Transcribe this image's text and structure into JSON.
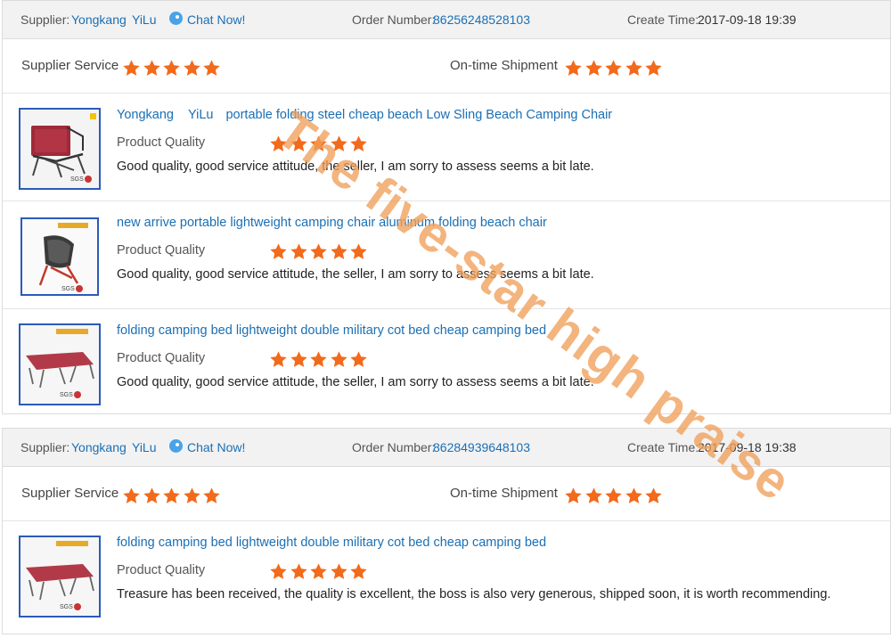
{
  "labels": {
    "supplier": "Supplier:",
    "chat_now": "Chat Now!",
    "order_number": "Order Number:",
    "create_time": "Create Time:",
    "supplier_service": "Supplier Service",
    "on_time_shipment": "On-time Shipment",
    "product_quality": "Product Quality"
  },
  "orders": [
    {
      "supplier_name_1": "Yongkang",
      "supplier_name_2": "YiLu",
      "order_number": "86256248528103",
      "create_time": "2017-09-18 19:39",
      "supplier_service_stars": 5,
      "on_time_shipment_stars": 5,
      "items": [
        {
          "title_prefix_1": "Yongkang",
          "title_prefix_2": "YiLu",
          "title": "portable folding steel cheap beach Low Sling Beach Camping Chair",
          "quality_stars": 5,
          "review": "Good quality, good service attitude, the seller, I am sorry to assess seems a bit late."
        },
        {
          "title": "new arrive portable lightweight camping chair aluminum folding beach chair",
          "quality_stars": 5,
          "review": "Good quality, good service attitude, the seller, I am sorry to assess seems a bit late."
        },
        {
          "title": "folding camping bed lightweight double military cot bed cheap camping bed",
          "quality_stars": 5,
          "review": "Good quality, good service attitude, the seller, I am sorry to assess seems a bit late."
        }
      ]
    },
    {
      "supplier_name_1": "Yongkang",
      "supplier_name_2": "YiLu",
      "order_number": "86284939648103",
      "create_time": "2017-09-18 19:38",
      "supplier_service_stars": 5,
      "on_time_shipment_stars": 5,
      "items": [
        {
          "title": "folding camping bed lightweight double military cot bed cheap camping bed",
          "quality_stars": 5,
          "review": "Treasure has been received, the quality is excellent, the boss is also very generous, shipped soon, it is worth recommending."
        }
      ]
    }
  ],
  "watermark": "The five-star high praise",
  "colors": {
    "star": "#f26a1b",
    "link": "#1a6fb5",
    "thumb_border": "#2a5bb8",
    "watermark": "#f0a05a"
  },
  "icons": {
    "star": "star-icon",
    "chat": "chat-icon"
  }
}
